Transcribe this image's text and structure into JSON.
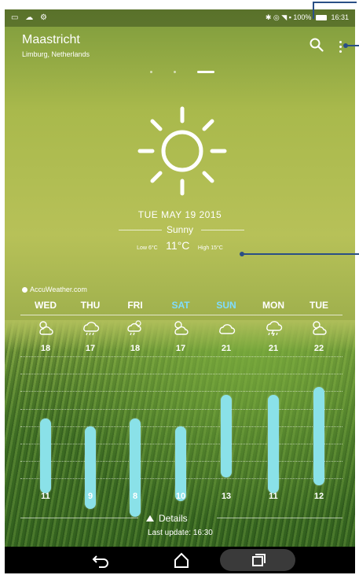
{
  "status": {
    "left_icons": "▭ ☁ ⚙",
    "battery": "100%",
    "time": "16:31"
  },
  "location": {
    "city": "Maastricht",
    "region": "Limburg, Netherlands"
  },
  "today": {
    "date": "TUE MAY 19 2015",
    "condition": "Sunny",
    "low": "Low 6°C",
    "current": "11°C",
    "high": "High 15°C"
  },
  "provider": "AccuWeather.com",
  "forecast": [
    {
      "day": "WED",
      "high": "18",
      "low": "11",
      "icon": "partly-sunny-icon",
      "weekend": false
    },
    {
      "day": "THU",
      "high": "17",
      "low": "9",
      "icon": "rain-cloud-icon",
      "weekend": false
    },
    {
      "day": "FRI",
      "high": "18",
      "low": "8",
      "icon": "sun-cloud-rain-icon",
      "weekend": false
    },
    {
      "day": "SAT",
      "high": "17",
      "low": "10",
      "icon": "partly-sunny-icon",
      "weekend": true
    },
    {
      "day": "SUN",
      "high": "21",
      "low": "13",
      "icon": "cloud-icon",
      "weekend": true
    },
    {
      "day": "MON",
      "high": "21",
      "low": "11",
      "icon": "thunderstorm-icon",
      "weekend": false
    },
    {
      "day": "TUE",
      "high": "22",
      "low": "12",
      "icon": "partly-sunny-icon",
      "weekend": false
    }
  ],
  "footer": {
    "details": "Details",
    "last_update": "Last update: 16:30"
  },
  "colors": {
    "bar": "#8ae1e8",
    "weekend": "#7fdcff"
  }
}
